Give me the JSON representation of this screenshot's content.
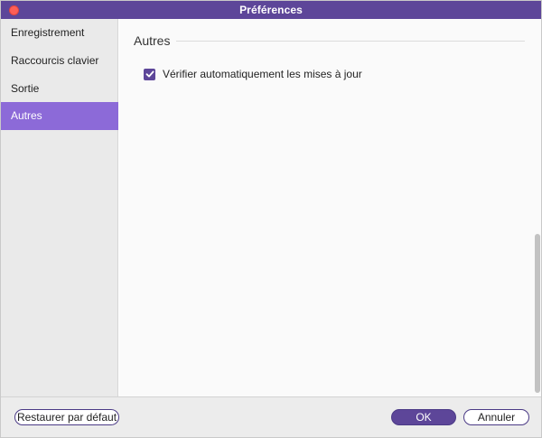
{
  "window": {
    "title": "Préférences"
  },
  "sidebar": {
    "items": [
      {
        "label": "Enregistrement",
        "active": false
      },
      {
        "label": "Raccourcis clavier",
        "active": false
      },
      {
        "label": "Sortie",
        "active": false
      },
      {
        "label": "Autres",
        "active": true
      }
    ]
  },
  "content": {
    "section_title": "Autres",
    "options": [
      {
        "label": "Vérifier automatiquement les mises à jour",
        "checked": true
      }
    ]
  },
  "footer": {
    "restore_label": "Restaurer par défaut",
    "ok_label": "OK",
    "cancel_label": "Annuler"
  },
  "colors": {
    "accent": "#5d4699",
    "sidebar_active": "#8c6ad8",
    "close_button": "#fd5f57"
  }
}
